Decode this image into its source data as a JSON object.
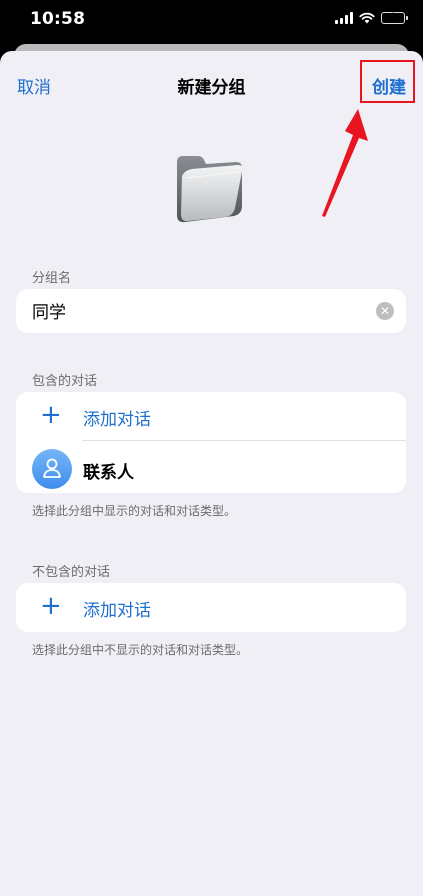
{
  "status_bar": {
    "time": "10:58"
  },
  "nav": {
    "cancel_label": "取消",
    "title": "新建分组",
    "create_label": "创建"
  },
  "folder_icon": "folder-icon",
  "group_name": {
    "section_label": "分组名",
    "value": "同学"
  },
  "included": {
    "section_label": "包含的对话",
    "add_label": "添加对话",
    "contact_label": "联系人",
    "footnote": "选择此分组中显示的对话和对话类型。"
  },
  "excluded": {
    "section_label": "不包含的对话",
    "add_label": "添加对话",
    "footnote": "选择此分组中不显示的对话和对话类型。"
  },
  "colors": {
    "accent": "#1e6fd0",
    "annotation": "#e8141f",
    "sheet_background": "#f0eff5"
  }
}
